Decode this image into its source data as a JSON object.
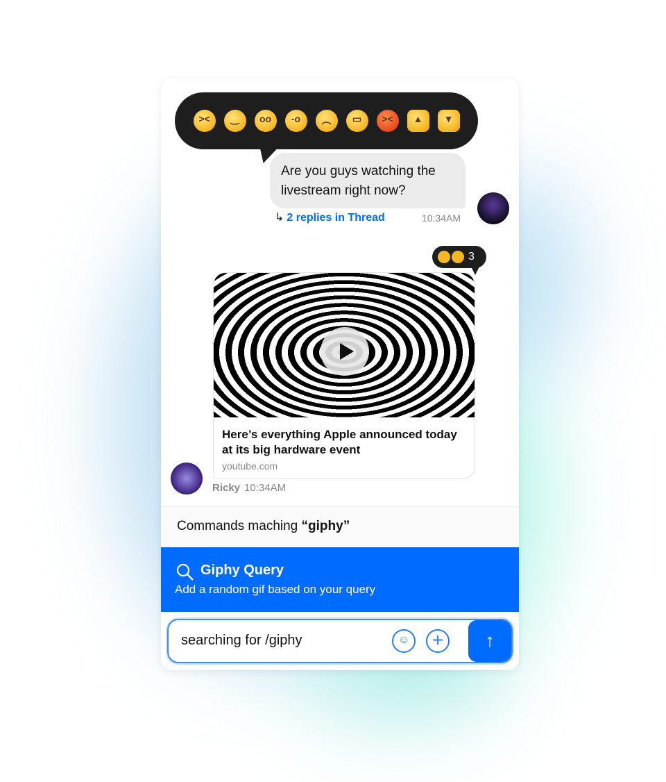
{
  "reaction_picker": {
    "emojis": [
      "laughing-face",
      "grinning-face",
      "flushed-face",
      "zany-face",
      "frowning-face",
      "grimacing-face",
      "angry-face",
      "thumbs-up",
      "thumbs-down"
    ]
  },
  "message1": {
    "text": "Are you guys watching the livestream right now?",
    "thread_link": "2 replies in Thread",
    "time": "10:34AM"
  },
  "message2": {
    "reactions": {
      "emojis": [
        "thumbs-up",
        "grinning-squint-face"
      ],
      "count": "3"
    },
    "link_title": "Here’s everything Apple announced today at its big hardware event",
    "link_source": "youtube.com",
    "author": "Ricky",
    "time": "10:34AM"
  },
  "commands": {
    "header_prefix": "Commands maching ",
    "query": "“giphy”",
    "item_title": "Giphy Query",
    "item_desc": "Add a random gif based on your query"
  },
  "composer": {
    "value": "searching for /giphy"
  },
  "colors": {
    "accent": "#006cff",
    "bubble": "#ebebeb",
    "dark": "#1e1e1e"
  }
}
